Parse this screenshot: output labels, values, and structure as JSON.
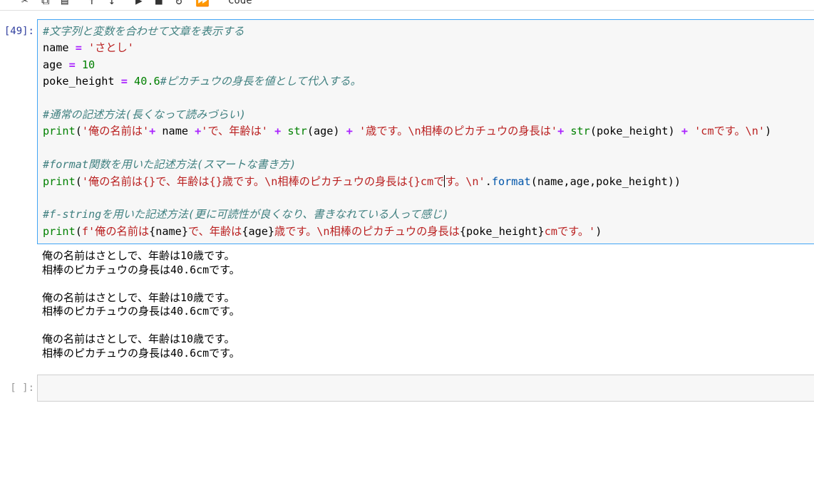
{
  "toolbar": {
    "icons": [
      "cut-icon",
      "copy-icon",
      "paste-icon",
      "move-up-icon",
      "move-down-icon",
      "run-icon",
      "stop-icon",
      "restart-icon",
      "fast-forward-icon"
    ],
    "cell_type": "Code"
  },
  "cell1": {
    "prompt": "[49]:",
    "lines": [
      [
        {
          "t": "#文字列と変数を合わせて文章を表示する",
          "c": "cm"
        }
      ],
      [
        {
          "t": "name ",
          "c": ""
        },
        {
          "t": "=",
          "c": "op"
        },
        {
          "t": " ",
          "c": ""
        },
        {
          "t": "'さとし'",
          "c": "st"
        }
      ],
      [
        {
          "t": "age ",
          "c": ""
        },
        {
          "t": "=",
          "c": "op"
        },
        {
          "t": " ",
          "c": ""
        },
        {
          "t": "10",
          "c": "nb"
        }
      ],
      [
        {
          "t": "poke_height ",
          "c": ""
        },
        {
          "t": "=",
          "c": "op"
        },
        {
          "t": " ",
          "c": ""
        },
        {
          "t": "40.6",
          "c": "nb"
        },
        {
          "t": "#ピカチュウの身長を値として代入する。",
          "c": "cm"
        }
      ],
      [],
      [
        {
          "t": "#通常の記述方法(長くなって読みづらい)",
          "c": "cm"
        }
      ],
      [
        {
          "t": "print",
          "c": "nb"
        },
        {
          "t": "(",
          "c": ""
        },
        {
          "t": "'俺の名前は'",
          "c": "st"
        },
        {
          "t": "+",
          "c": "op"
        },
        {
          "t": " name ",
          "c": ""
        },
        {
          "t": "+",
          "c": "op"
        },
        {
          "t": "'で、年齢は'",
          "c": "st"
        },
        {
          "t": " ",
          "c": ""
        },
        {
          "t": "+",
          "c": "op"
        },
        {
          "t": " ",
          "c": ""
        },
        {
          "t": "str",
          "c": "nb"
        },
        {
          "t": "(age) ",
          "c": ""
        },
        {
          "t": "+",
          "c": "op"
        },
        {
          "t": " ",
          "c": ""
        },
        {
          "t": "'歳です。\\n相棒のピカチュウの身長は'",
          "c": "st"
        },
        {
          "t": "+",
          "c": "op"
        },
        {
          "t": " ",
          "c": ""
        },
        {
          "t": "str",
          "c": "nb"
        },
        {
          "t": "(poke_height) ",
          "c": ""
        },
        {
          "t": "+",
          "c": "op"
        },
        {
          "t": " ",
          "c": ""
        },
        {
          "t": "'cmです。\\n'",
          "c": "st"
        },
        {
          "t": ")",
          "c": ""
        }
      ],
      [],
      [
        {
          "t": "#format関数を用いた記述方法(スマートな書き方)",
          "c": "cm"
        }
      ],
      [
        {
          "t": "print",
          "c": "nb"
        },
        {
          "t": "(",
          "c": ""
        },
        {
          "t": "'俺の名前は{}で、年齢は{}歳です。\\n相棒のピカチュウの身長は{}cmで",
          "c": "st"
        },
        {
          "t": "",
          "c": "caret"
        },
        {
          "t": "す。\\n'",
          "c": "st"
        },
        {
          "t": ".",
          "c": ""
        },
        {
          "t": "format",
          "c": "fn"
        },
        {
          "t": "(name,age,poke_height))",
          "c": ""
        }
      ],
      [],
      [
        {
          "t": "#f-stringを用いた記述方法(更に可読性が良くなり、書きなれている人って感じ)",
          "c": "cm"
        }
      ],
      [
        {
          "t": "print",
          "c": "nb"
        },
        {
          "t": "(",
          "c": ""
        },
        {
          "t": "f'俺の名前は",
          "c": "st"
        },
        {
          "t": "{name}",
          "c": ""
        },
        {
          "t": "で、年齢は",
          "c": "st"
        },
        {
          "t": "{age}",
          "c": ""
        },
        {
          "t": "歳です。\\n相棒のピカチュウの身長は",
          "c": "st"
        },
        {
          "t": "{poke_height}",
          "c": ""
        },
        {
          "t": "cmです。'",
          "c": "st"
        },
        {
          "t": ")",
          "c": ""
        }
      ]
    ]
  },
  "output": {
    "lines": [
      "俺の名前はさとしで、年齢は10歳です。",
      "相棒のピカチュウの身長は40.6cmです。",
      "",
      "俺の名前はさとしで、年齢は10歳です。",
      "相棒のピカチュウの身長は40.6cmです。",
      "",
      "俺の名前はさとしで、年齢は10歳です。",
      "相棒のピカチュウの身長は40.6cmです。"
    ]
  },
  "cell2": {
    "prompt": "[ ]:"
  }
}
